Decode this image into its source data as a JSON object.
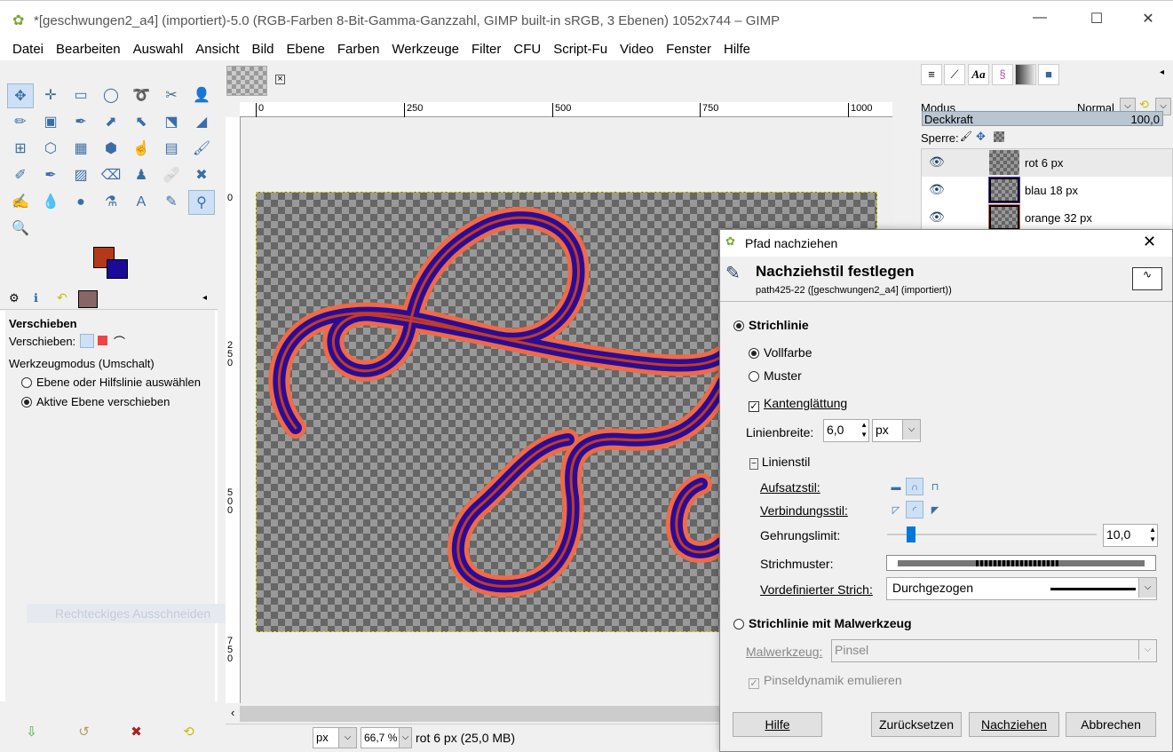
{
  "window": {
    "title": "*[geschwungen2_a4] (importiert)-5.0 (RGB-Farben 8-Bit-Gamma-Ganzzahl, GIMP built-in sRGB, 3 Ebenen) 1052x744 – GIMP",
    "minimize": "—",
    "maximize": "☐",
    "close": "✕"
  },
  "menu": [
    "Datei",
    "Bearbeiten",
    "Auswahl",
    "Ansicht",
    "Bild",
    "Ebene",
    "Farben",
    "Werkzeuge",
    "Filter",
    "CFU",
    "Script-Fu",
    "Video",
    "Fenster",
    "Hilfe"
  ],
  "colors": {
    "foreground": "#b5381a",
    "background": "#1a0a99",
    "stroke_outer": "#f06a45",
    "stroke_mid": "#2a0d96",
    "stroke_center": "#c23a2a"
  },
  "tool_options": {
    "title": "Verschieben",
    "move_label": "Verschieben:",
    "mode_label": "Werkzeugmodus (Umschalt)",
    "options": [
      "Ebene oder Hilfslinie auswählen",
      "Aktive Ebene verschieben"
    ],
    "selected": 1
  },
  "ghost_tooltip": "Rechteckiges Ausschneiden",
  "rulers": {
    "h": [
      "0",
      "250",
      "500",
      "750",
      "1000"
    ],
    "v": [
      "0",
      "250",
      "500",
      "750"
    ]
  },
  "status": {
    "unit": "px",
    "zoom": "66,7 %",
    "info": "rot 6 px (25,0 MB)"
  },
  "layers_panel": {
    "mode_label": "Modus",
    "mode_value": "Normal",
    "opacity_label": "Deckkraft",
    "opacity_value": "100,0",
    "lock_label": "Sperre:",
    "layers": [
      {
        "name": "rot 6 px",
        "visible": true
      },
      {
        "name": "blau 18 px",
        "visible": true
      },
      {
        "name": "orange 32 px",
        "visible": true
      }
    ]
  },
  "dialog": {
    "window_title": "Pfad nachziehen",
    "heading": "Nachziehstil festlegen",
    "subtitle": "path425-22 ([geschwungen2_a4] (importiert))",
    "stroke_line": "Strichlinie",
    "solid": "Vollfarbe",
    "pattern": "Muster",
    "antialias": "Kantenglättung",
    "line_width_label": "Linienbreite:",
    "line_width": "6,0",
    "line_width_unit": "px",
    "line_style": "Linienstil",
    "cap_label": "Aufsatzstil:",
    "join_label": "Verbindungsstil:",
    "miter_label": "Gehrungslimit:",
    "miter_value": "10,0",
    "miter_fraction": 0.1,
    "dash_label": "Strichmuster:",
    "preset_label": "Vordefinierter Strich:",
    "preset_value": "Durchgezogen",
    "paint_tool_stroke": "Strichlinie mit Malwerkzeug",
    "paint_tool_label": "Malwerkzeug:",
    "paint_tool_value": "Pinsel",
    "emulate": "Pinseldynamik emulieren",
    "buttons": {
      "help": "Hilfe",
      "reset": "Zurücksetzen",
      "stroke": "Nachziehen",
      "cancel": "Abbrechen"
    }
  }
}
